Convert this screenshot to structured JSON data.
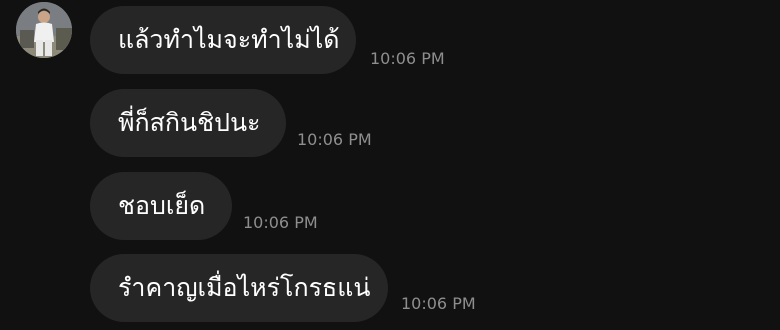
{
  "conversation": {
    "sender_avatar_icon": "person-photo-icon",
    "messages": [
      {
        "text": "แล้วทำไมจะทำไม่ได้",
        "time": "10:06 PM"
      },
      {
        "text": "พี่ก็สกินชิปนะ",
        "time": "10:06 PM"
      },
      {
        "text": "ชอบเย็ด",
        "time": "10:06 PM"
      },
      {
        "text": "รำคาญเมื่อไหร่โกรธแน่",
        "time": "10:06 PM"
      }
    ]
  },
  "colors": {
    "background": "#111111",
    "bubble": "#262626",
    "message_text": "#ffffff",
    "timestamp": "#8e8e8e"
  }
}
